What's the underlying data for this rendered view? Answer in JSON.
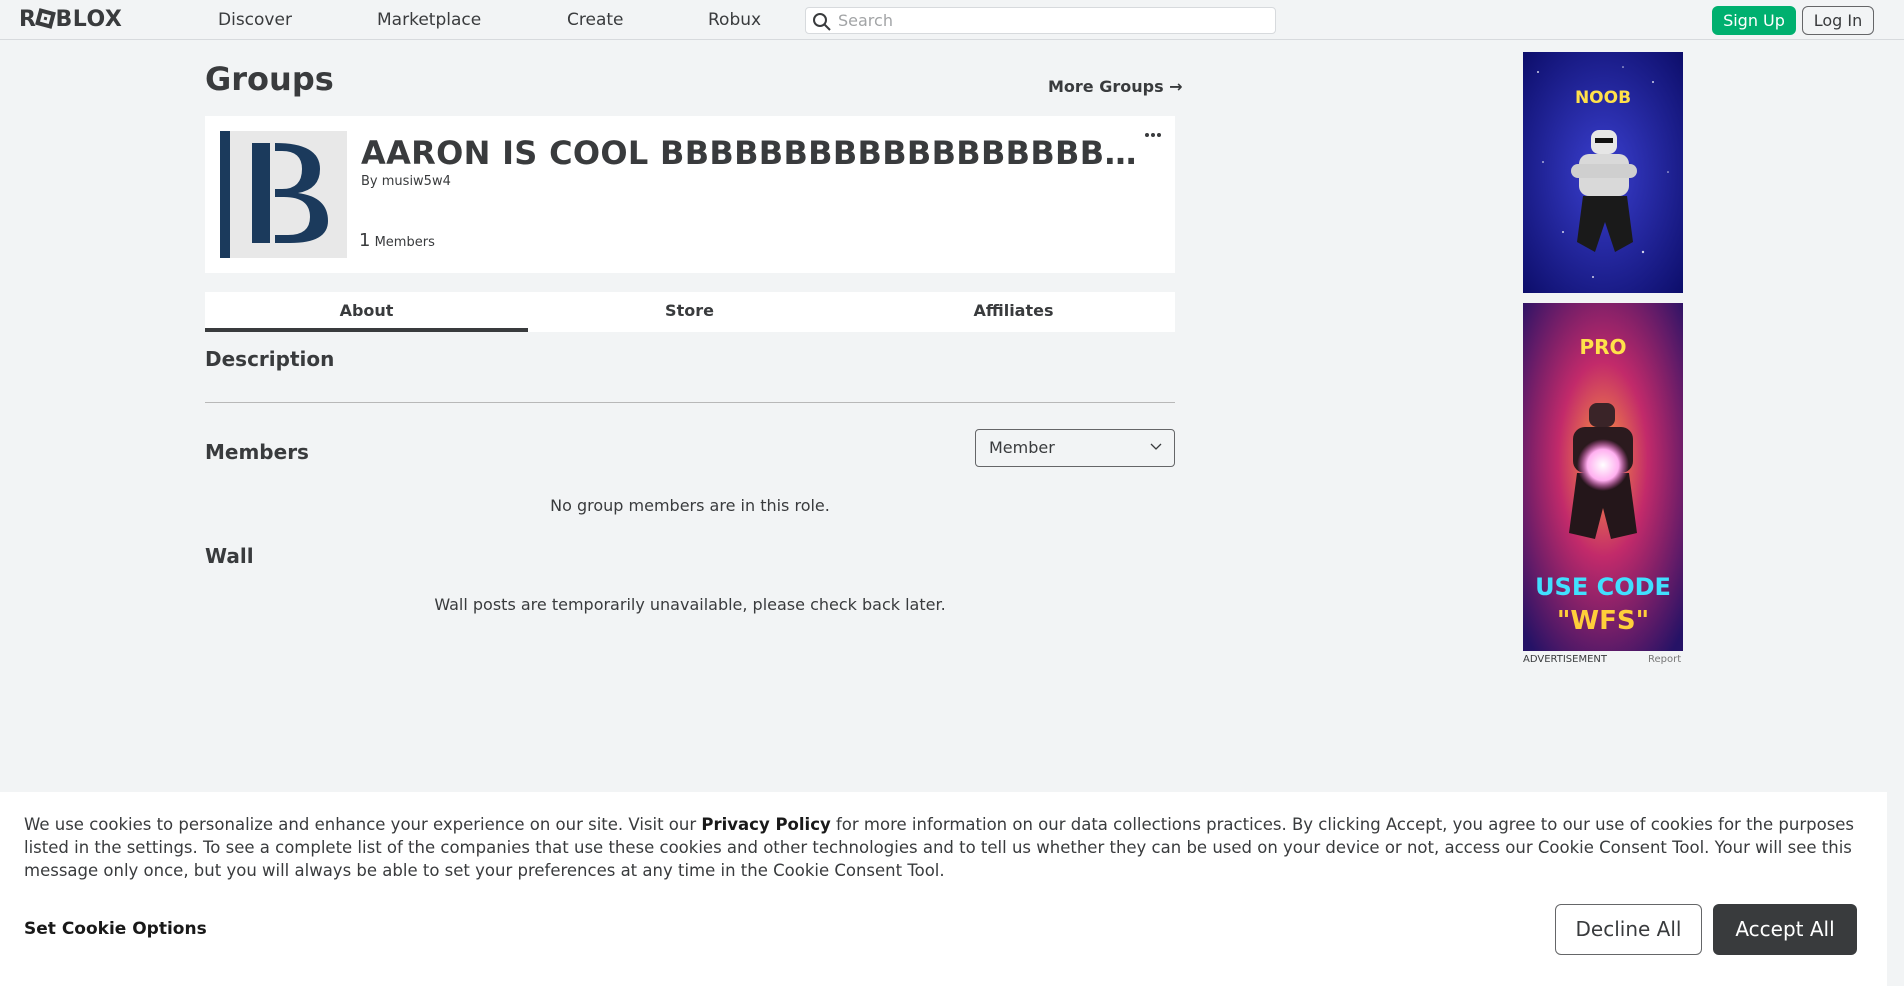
{
  "nav": {
    "logo": "ROBLOX",
    "links": [
      "Discover",
      "Marketplace",
      "Create",
      "Robux"
    ],
    "search_placeholder": "Search",
    "signup_label": "Sign Up",
    "login_label": "Log In"
  },
  "page": {
    "title": "Groups",
    "more_groups": "More Groups →"
  },
  "group": {
    "name": "AARON IS COOL BBBBBBBBBBBBBBBBBBBBBBBB",
    "by_prefix": "By",
    "owner": "musiw5w4",
    "member_count": "1",
    "member_count_label": "Members",
    "emblem_letter": "B"
  },
  "tabs": [
    "About",
    "Store",
    "Affiliates"
  ],
  "sections": {
    "description_title": "Description",
    "members_title": "Members",
    "role_selected": "Member",
    "members_empty": "No group members are in this role.",
    "wall_title": "Wall",
    "wall_empty": "Wall posts are temporarily unavailable, please check back later."
  },
  "ads": {
    "noob_text": "NOOB",
    "pro_text": "PRO",
    "code_line1": "USE CODE",
    "code_line2": "\"WFS\"",
    "label": "ADVERTISEMENT",
    "report": "Report"
  },
  "cookie": {
    "text_before": "We use cookies to personalize and enhance your experience on our site. Visit our ",
    "privacy_link": "Privacy Policy",
    "text_after": " for more information on our data collections practices. By clicking Accept, you agree to our use of cookies for the purposes listed in the settings. To see a complete list of the companies that use these cookies and other technologies and to tell us whether they can be used on your device or not, access our Cookie Consent Tool. Your will see this message only once, but you will always be able to set your preferences at any time in the Cookie Consent Tool.",
    "options_label": "Set Cookie Options",
    "decline_label": "Decline All",
    "accept_label": "Accept All"
  },
  "colors": {
    "background": "#f2f4f5",
    "signup_green": "#00b06f",
    "text": "#393b3d",
    "accept_bg": "#393b3d",
    "emblem_blue": "#1b3a5c"
  },
  "icons": [
    "search-icon",
    "more-icon",
    "arrow-right-icon",
    "chevron-down-icon"
  ]
}
